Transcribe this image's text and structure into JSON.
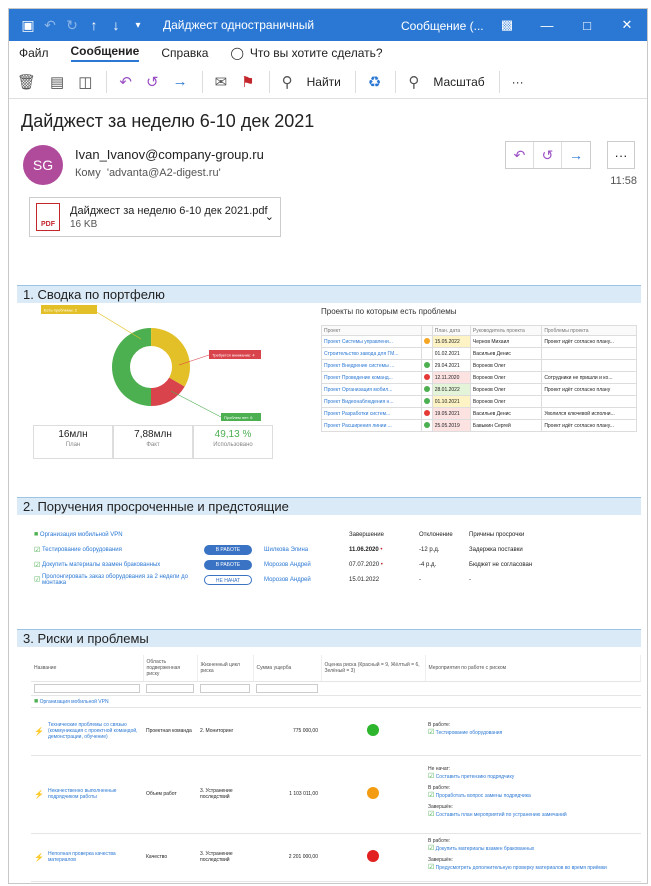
{
  "titlebar": {
    "title": "Дайджест одностраничный",
    "subtitle": "Сообщение (...",
    "icons": [
      "save-icon",
      "undo-icon",
      "redo-icon",
      "up-arrow-icon",
      "down-arrow-icon",
      "customize-icon"
    ]
  },
  "menu": {
    "file": "Файл",
    "message": "Сообщение",
    "help": "Справка",
    "search_hint": "Что вы хотите сделать?"
  },
  "ribbon": {
    "find": "Найти",
    "zoom": "Масштаб",
    "more": "···"
  },
  "mail": {
    "subject": "Дайджест за неделю 6-10 дек 2021",
    "initials": "SG",
    "sender": "Ivan_Ivanov@company-group.ru",
    "to_label": "Кому",
    "to": "'advanta@A2-digest.ru'",
    "time": "11:58",
    "attachment_name": "Дайджест за неделю 6-10 дек 2021.pdf",
    "attachment_size": "16 KB",
    "pdf_label": "PDF"
  },
  "section1": {
    "title": "1. Сводка по портфелю",
    "donut_labels": [
      "Есть проблемы: 2",
      "Требуется внимание: 4",
      "Проблем нет: 6"
    ],
    "kpis": [
      {
        "value": "16млн",
        "label": "План"
      },
      {
        "value": "7,88млн",
        "label": "Факт"
      },
      {
        "value": "49,13 %",
        "label": "Использовано"
      }
    ],
    "table_title": "Проекты по которым есть проблемы",
    "headers": [
      "Проект",
      "",
      "План. дата",
      "Руководитель проекта",
      "Проблемы проекта"
    ],
    "rows": [
      {
        "name": "Проект Системы управлени...",
        "color": "#f5a623",
        "date": "15.05.2022",
        "datebg": "#fdf3c4",
        "lead": "Чернов Михаил",
        "problem": "Проект идёт согласно плану..."
      },
      {
        "name": "Строительство завода для ГМ...",
        "color": "",
        "date": "01.02.2021",
        "datebg": "",
        "lead": "Васильев Денис",
        "problem": ""
      },
      {
        "name": "Проект Внедрение системы ...",
        "color": "#4caf50",
        "date": "29.04.2021",
        "datebg": "",
        "lead": "Воронов Олег",
        "problem": ""
      },
      {
        "name": "Проект Проведение команд...",
        "color": "#e53935",
        "date": "12.11.2020",
        "datebg": "#fde2e2",
        "lead": "Воронов Олег",
        "problem": "Сотрудники не пришли и ко..."
      },
      {
        "name": "Проект Организация мобил...",
        "color": "#4caf50",
        "date": "28.01.2022",
        "datebg": "#e4f4d8",
        "lead": "Воронов Олег",
        "problem": "Проект идёт согласно плану"
      },
      {
        "name": "Проект Видеонаблюдения н...",
        "color": "#4caf50",
        "date": "01.10.2021",
        "datebg": "#fdf3c4",
        "lead": "Воронов Олег",
        "problem": ""
      },
      {
        "name": "Проект Разработки систем...",
        "color": "#e53935",
        "date": "19.05.2021",
        "datebg": "#fde2e2",
        "lead": "Васильев Денис",
        "problem": "Уволился ключевой исполни..."
      },
      {
        "name": "Проект Расширения линии ...",
        "color": "#4caf50",
        "date": "25.05.2019",
        "datebg": "#fde2e2",
        "lead": "Бавыкин Сергей",
        "problem": "Проект идёт согласно плану..."
      }
    ]
  },
  "section2": {
    "title": "2. Поручения просроченные и предстоящие",
    "headers": [
      "Завершение",
      "Отклонение",
      "Причины просрочки"
    ],
    "group": "Организация мобильной VPN",
    "rows": [
      {
        "task": "Тестирование оборудования",
        "status": "В РАБОТЕ",
        "outline": false,
        "person": "Шилкова Элина",
        "date": "11.06.2020",
        "bold": true,
        "star": true,
        "dev": "-12 р.д.",
        "reason": "Задержка поставки"
      },
      {
        "task": "Докупить материалы взамен бракованных",
        "status": "В РАБОТЕ",
        "outline": false,
        "person": "Морозов Андрей",
        "date": "07.07.2020",
        "bold": false,
        "star": true,
        "dev": "-4 р.д.",
        "reason": "Бюджет не согласован"
      },
      {
        "task": "Пролонгировать заказ оборудования за 2 недели до монтажа",
        "status": "НЕ НАЧАТ",
        "outline": true,
        "person": "Морозов Андрей",
        "date": "15.01.2022",
        "bold": false,
        "star": false,
        "dev": "-",
        "reason": "-"
      }
    ]
  },
  "section3": {
    "title": "3. Риски и проблемы",
    "headers": [
      "Название",
      "Область подверженная риску",
      "Жизненный цикл риска",
      "Сумма ущерба",
      "Оценка риска (Красный = 9, Жёлтый = 6, Зелёный = 3)",
      "Мероприятия по работе с риском"
    ],
    "group": "Организация мобильной VPN",
    "rows": [
      {
        "name": "Технические проблемы со связью (коммуникация с проектной командой, демонстрации, обучение)",
        "area": "Проектная команда",
        "cycle": "2. Мониторинг",
        "sum": "775 000,00",
        "color": "#2db52d",
        "measures": [
          {
            "h": "В работе:",
            "items": [
              "Тестирование оборудования"
            ]
          }
        ]
      },
      {
        "name": "Некачественно выполненные подрядчиком работы",
        "area": "Объем работ",
        "cycle": "3. Устранение последствий",
        "sum": "1 103 011,00",
        "color": "#f39c12",
        "measures": [
          {
            "h": "Не начат:",
            "items": [
              "Составить претензию подрядчику"
            ]
          },
          {
            "h": "В работе:",
            "items": [
              "Проработать вопрос замены подрядчика"
            ]
          },
          {
            "h": "Завершён:",
            "items": [
              "Составить план мероприятий по устранению замечаний"
            ]
          }
        ]
      },
      {
        "name": "Неполная проверка качества материалов",
        "area": "Качество",
        "cycle": "3. Устранение последствий",
        "sum": "2 201 000,00",
        "color": "#e32020",
        "measures": [
          {
            "h": "В работе:",
            "items": [
              "Докупить материалы взамен бракованных"
            ]
          },
          {
            "h": "Завершён:",
            "items": [
              "Предусмотреть дополнительную проверку материалов во время приёмки"
            ]
          }
        ]
      }
    ]
  }
}
